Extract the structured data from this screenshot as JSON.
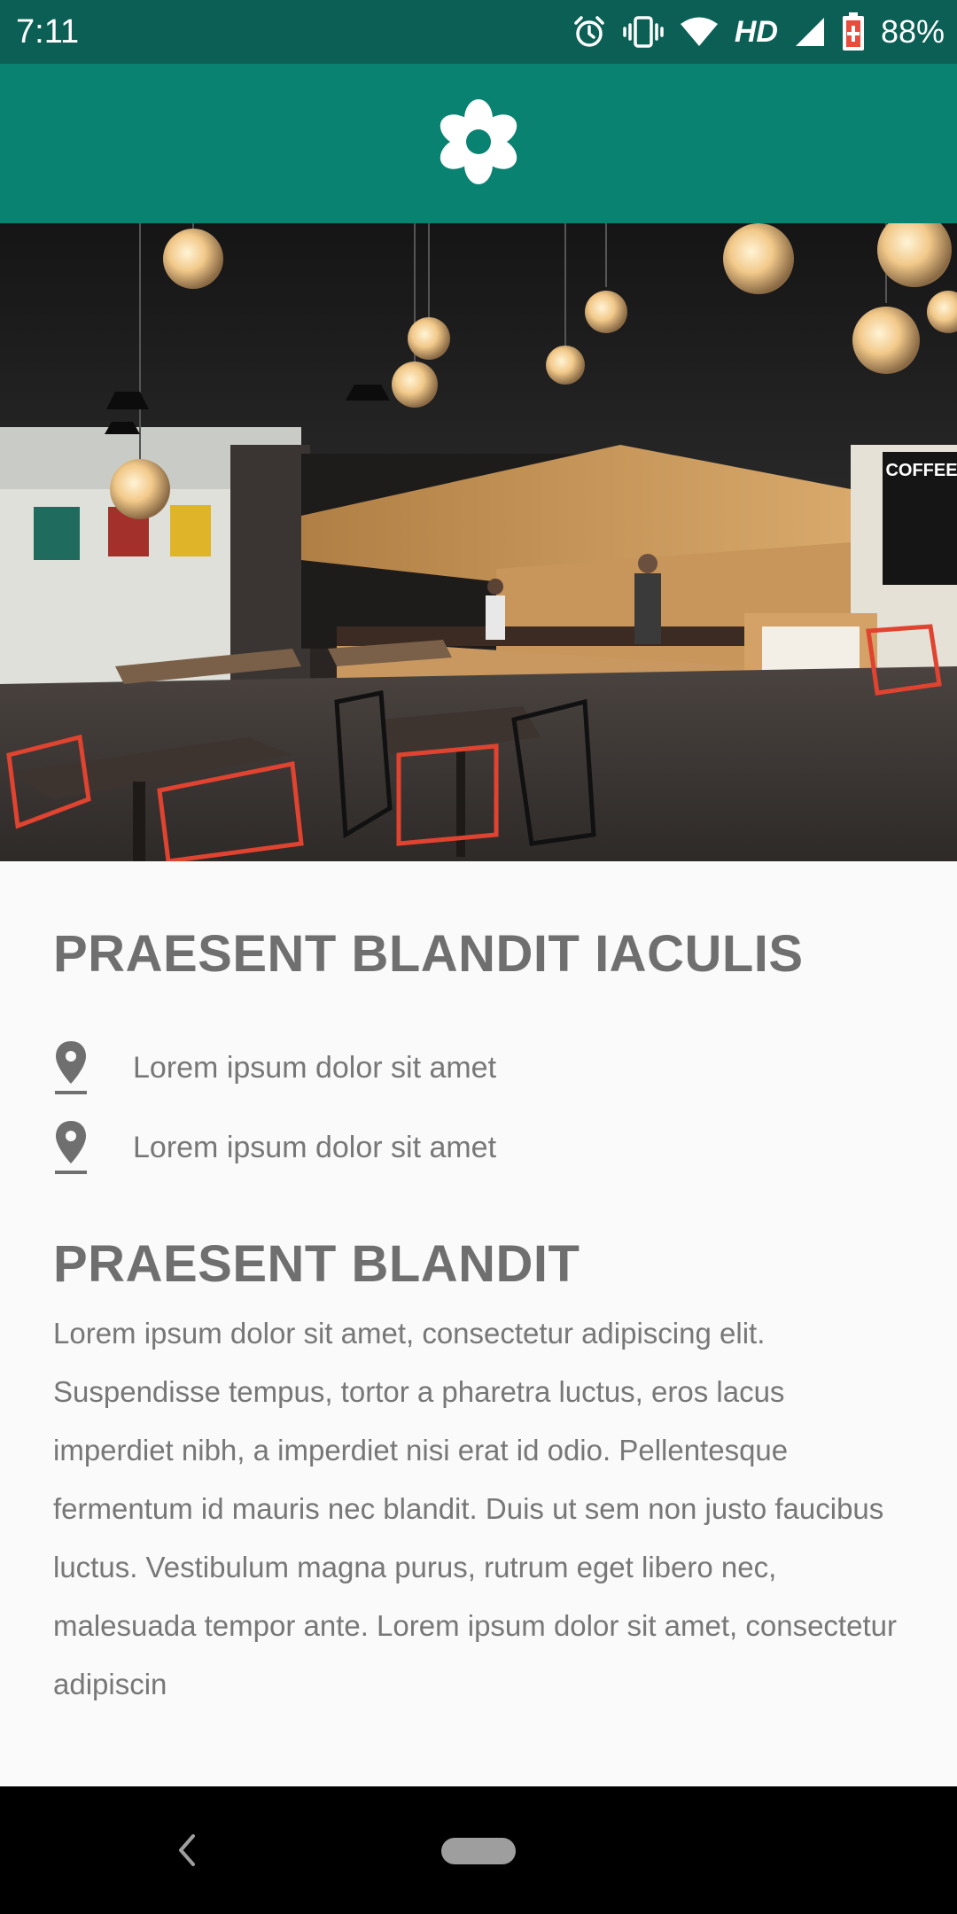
{
  "status_bar": {
    "time": "7:11",
    "network_label": "HD",
    "battery_percent": "88%",
    "icons": [
      "alarm-icon",
      "vibrate-icon",
      "wifi-icon",
      "signal-icon",
      "battery-icon"
    ]
  },
  "app_bar": {
    "logo_icon": "flower-icon",
    "color": "#0a8272"
  },
  "hero": {
    "image_description_icon": "cafe-interior-photo"
  },
  "content": {
    "title": "PRAESENT BLANDIT IACULIS",
    "locations": [
      {
        "icon": "location-pin-icon",
        "text": "Lorem ipsum dolor sit amet"
      },
      {
        "icon": "location-pin-icon",
        "text": "Lorem ipsum dolor sit amet"
      }
    ],
    "subtitle": "PRAESENT BLANDIT",
    "body": "Lorem ipsum dolor sit amet, consectetur adipiscing elit. Suspendisse tempus, tortor a pharetra luctus, eros lacus imperdiet nibh, a imperdiet nisi erat id odio. Pellentesque fermentum id mauris nec blandit. Duis ut sem non justo faucibus luctus. Vestibulum magna purus, rutrum eget libero nec, malesuada tempor ante. Lorem ipsum dolor sit amet, consectetur adipiscin"
  },
  "nav_bar": {
    "back_icon": "back-chevron-icon",
    "home_icon": "home-pill-icon"
  },
  "colors": {
    "status_bar": "#0b5f55",
    "app_bar": "#0a8272",
    "heading_text": "#6f6f6f",
    "body_text": "#777777",
    "background": "#fafafa"
  }
}
